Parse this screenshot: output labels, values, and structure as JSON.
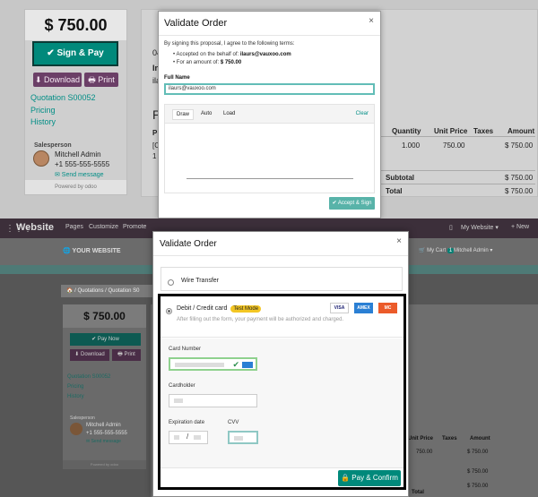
{
  "top": {
    "sidebar": {
      "amount": "$ 750.00",
      "sign_pay": "✔ Sign & Pay",
      "download": "⬇ Download",
      "print": "🖶 Print",
      "links": [
        "Quotation S00052",
        "Pricing",
        "History"
      ],
      "salesperson_label": "Salesperson",
      "salesperson_name": "Mitchell Admin",
      "salesperson_phone": "+1 555-555-5555",
      "send_message": "✉ Send message",
      "powered_by": "Powered by odoo"
    },
    "main": {
      "fragments": [
        "04",
        "In",
        "ila",
        "P",
        "P",
        "[C",
        "1"
      ],
      "headers": [
        "Quantity",
        "Unit Price",
        "Taxes",
        "Amount"
      ],
      "row": {
        "quantity": "1.000",
        "unit_price": "750.00",
        "amount": "$ 750.00"
      },
      "subtotal_label": "Subtotal",
      "subtotal_value": "$ 750.00",
      "total_label": "Total",
      "total_value": "$ 750.00"
    },
    "modal": {
      "title": "Validate Order",
      "close": "×",
      "terms": "By signing this proposal, I agree to the following terms:",
      "accepted_prefix": "Accepted on the behalf of: ",
      "accepted_value": "ilaurs@vauxoo.com",
      "amount_prefix": "For an amount of: ",
      "amount_value": "$ 750.00",
      "full_name_label": "Full Name",
      "full_name_value": "ilaurs@vauxoo.com",
      "tabs": [
        "Draw",
        "Auto",
        "Load"
      ],
      "clear": "Clear",
      "accept_sign": "✔ Accept & Sign"
    }
  },
  "bottom": {
    "nav": {
      "grid_icon": "⋮⋮⋮",
      "brand": "Website",
      "items": [
        "Pages",
        "Customize",
        "Promote"
      ],
      "mobile_icon": "▯",
      "my_website": "My Website ▾",
      "new": "+ New"
    },
    "header": {
      "logo": "🌐 YOUR WEBSITE",
      "cart": "🛒 My Cart",
      "cart_count": "1",
      "user": "Mitchell Admin ▾"
    },
    "breadcrumb": "🏠 / Quotations / Quotation S0",
    "sidebar": {
      "amount": "$ 750.00",
      "pay_now": "✔ Pay Now",
      "download": "⬇ Download",
      "print": "🖶 Print",
      "links": [
        "Quotation S00052",
        "Pricing",
        "History"
      ],
      "salesperson_label": "Salesperson",
      "salesperson_name": "Mitchell Admin",
      "salesperson_phone": "+1 555-555-5555",
      "send_message": "✉ Send message",
      "powered_by": "Powered by odoo"
    },
    "table": {
      "headers": [
        "Unit Price",
        "Taxes",
        "Amount"
      ],
      "amounts": [
        "750.00",
        "$ 750.00",
        "$ 750.00",
        "$ 750.00"
      ],
      "total_label": "Total"
    },
    "modal": {
      "title": "Validate Order",
      "close": "×",
      "wire_transfer": "Wire Transfer",
      "card_label": "Debit / Credit card",
      "test_mode": "Test Mode",
      "note": "After filling out the form, your payment will be authorized and charged.",
      "card_icons": [
        "VISA",
        "AMEX",
        "MC"
      ],
      "card_number_label": "Card Number",
      "cardholder_label": "Cardholder",
      "expiration_label": "Expiration date",
      "expiration_separator": "/",
      "cvv_label": "CVV",
      "pay_confirm": "🔒 Pay & Confirm"
    }
  }
}
